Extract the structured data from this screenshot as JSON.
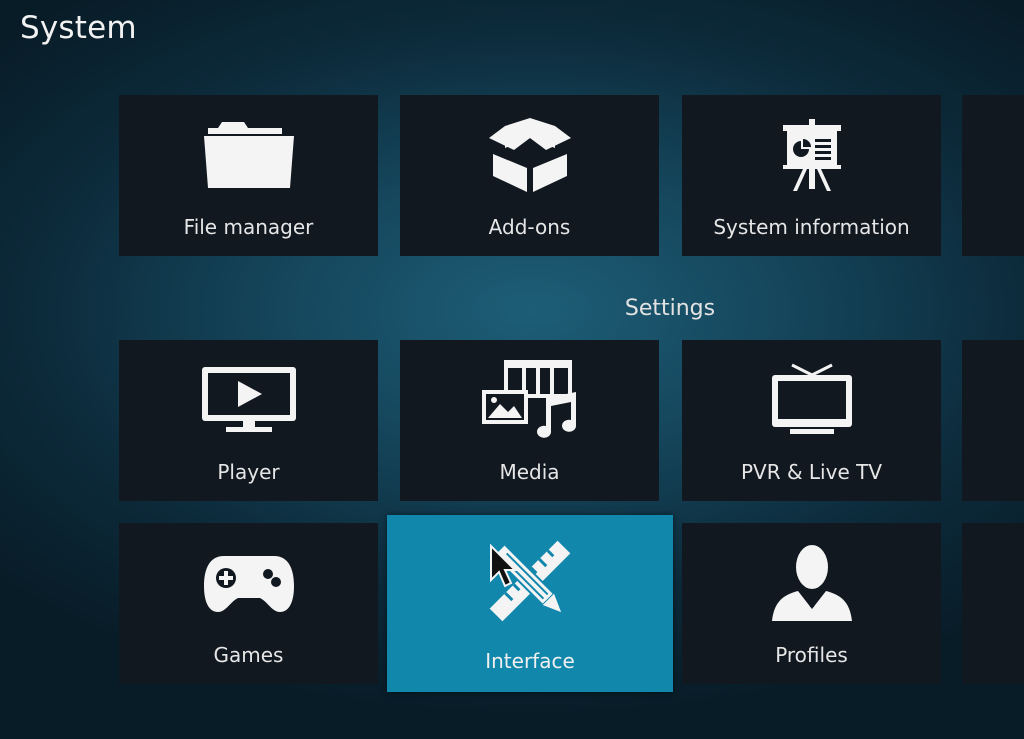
{
  "header": {
    "title": "System"
  },
  "sections": {
    "settings_label": "Settings"
  },
  "tiles": {
    "file_manager": {
      "label": "File manager",
      "icon": "folder-icon"
    },
    "addons": {
      "label": "Add-ons",
      "icon": "open-box-icon"
    },
    "system_information": {
      "label": "System information",
      "icon": "presentation-board-icon"
    },
    "player": {
      "label": "Player",
      "icon": "tv-play-icon"
    },
    "media": {
      "label": "Media",
      "icon": "media-film-photo-music-icon"
    },
    "pvr": {
      "label": "PVR & Live TV",
      "icon": "tv-antenna-icon"
    },
    "games": {
      "label": "Games",
      "icon": "gamepad-icon"
    },
    "interface": {
      "label": "Interface",
      "icon": "pencil-ruler-icon",
      "focused": true
    },
    "profiles": {
      "label": "Profiles",
      "icon": "person-silhouette-icon"
    }
  },
  "colors": {
    "focus": "#1187ac",
    "tile": "#111820",
    "background": "#15465c"
  }
}
